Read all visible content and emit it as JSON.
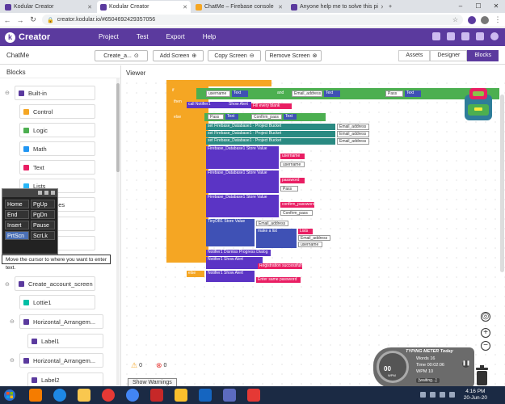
{
  "browser": {
    "tabs": [
      {
        "label": "Kodular Creator",
        "active": false,
        "favicon_color": "#5b3a9e"
      },
      {
        "label": "Kodular Creator",
        "active": true,
        "favicon_color": "#5b3a9e"
      },
      {
        "label": "ChatMe – Firebase console",
        "active": false,
        "favicon_color": "#f5a623"
      },
      {
        "label": "Anyone help me to solve this pi",
        "active": false,
        "favicon_color": "#5b3a9e"
      }
    ],
    "new_tab": "+",
    "url": "creator.kodular.io/#6504692429357056"
  },
  "app": {
    "brand": "Creator",
    "menu": [
      "Project",
      "Test",
      "Export",
      "Help"
    ]
  },
  "project": {
    "name": "ChatMe",
    "screen_select": "Create_a...",
    "add_screen": "Add Screen",
    "copy_screen": "Copy Screen",
    "remove_screen": "Remove Screen",
    "views": [
      "Assets",
      "Designer",
      "Blocks"
    ],
    "active_view": "Blocks"
  },
  "blocks_panel": {
    "title": "Blocks",
    "builtin": "Built-in",
    "categories": [
      {
        "label": "Control",
        "color": "#f5a623"
      },
      {
        "label": "Logic",
        "color": "#4caf50"
      },
      {
        "label": "Math",
        "color": "#2196f3"
      },
      {
        "label": "Text",
        "color": "#e91e63"
      },
      {
        "label": "Lists",
        "color": "#29b6f6"
      },
      {
        "label": "Dictionaries",
        "color": "#3f51b5"
      }
    ],
    "screen": "Create_account_screen",
    "components": [
      {
        "label": "Lottie1",
        "color": "#00bfa5",
        "level": 1
      },
      {
        "label": "Horizontal_Arrangem...",
        "color": "#5b3a9e",
        "level": 1
      },
      {
        "label": "Label1",
        "color": "#5b3a9e",
        "level": 2
      },
      {
        "label": "Horizontal_Arrangem...",
        "color": "#5b3a9e",
        "level": 1
      },
      {
        "label": "Label2",
        "color": "#5b3a9e",
        "level": 2
      }
    ]
  },
  "keyboard": {
    "keys": [
      "Home",
      "PgUp",
      "End",
      "PgDn",
      "Insert",
      "Pause",
      "PrtScn",
      "ScrLk"
    ],
    "selected": "PrtScn",
    "tooltip": "Move the cursor to where you want to enter text."
  },
  "viewer": {
    "title": "Viewer",
    "blocks": {
      "row1": [
        "username",
        "Text",
        "Email_address",
        "Text",
        "Pass",
        "Text"
      ],
      "notifier1": "Notifier1",
      "show_alert": "Show Alert",
      "fill_every_blank": "Fill every blank",
      "pass": "Pass",
      "text": "Text",
      "confirm_pass": "Confirm_pass",
      "firebase_database": "Firebase_Database1",
      "project_bucket": "Project Bucket",
      "email_address": "Email_address",
      "store_value": "Store Value",
      "tag": "tag",
      "value_to_store": "value To Store",
      "username_str": "username",
      "password_str": "password",
      "confirm_password_str": "confirm_password",
      "tinydb": "TinyDB1",
      "make_a_list": "make a list",
      "lists_str": "Lists",
      "dismiss_progress": "Dismiss Progress Dialog",
      "notice": "notice",
      "registration_success": "Registration successfully",
      "enter_same_password": "Enter same password",
      "else": "else",
      "call": "call",
      "set": "set",
      "to": "to",
      "if": "if",
      "then": "then",
      "and": "and"
    },
    "warnings": {
      "warn_count": "0",
      "error_count": "0",
      "button": "Show Warnings"
    },
    "zoom": {
      "in": "+",
      "out": "−"
    }
  },
  "typing_meter": {
    "title": "TYPING METER Today",
    "words_label": "Words",
    "words": "16",
    "time_label": "Time",
    "time": "00:02:06",
    "wpm_label": "WPM",
    "wpm": "10",
    "gauge_value": "00",
    "gauge_unit": "WPM",
    "status": "[waiting...]"
  },
  "taskbar": {
    "time": "4:16 PM",
    "date": "20-Jun-20"
  }
}
